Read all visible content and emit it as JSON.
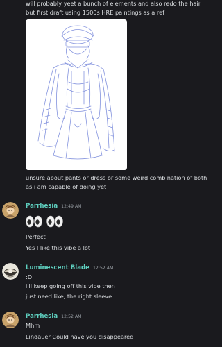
{
  "messages": {
    "first": {
      "line1": "will probably yeet a bunch of elements and also redo the hair",
      "line2": "but first draft using 1500s HRE paintings as a ref",
      "caption1": "unsure about pants or dress or some weird combination of both",
      "caption2": "as i am capable of doing yet"
    },
    "parrhesia1": {
      "username": "Parrhesia",
      "timestamp": "12:49 AM",
      "emoji": "eyes-emoji",
      "line1": "Perfect",
      "line2": "Yes I like this vibe a lot"
    },
    "luminescent": {
      "username": "Luminescent Blade",
      "timestamp": "12:52 AM",
      "line1": ":D",
      "line2": "i'll keep going off this vibe then",
      "line3": "just need like, the right sleeve"
    },
    "parrhesia2": {
      "username": "Parrhesia",
      "timestamp": "12:52 AM",
      "line1": "Mhm",
      "line2": "Lindauer Could have you disappeared"
    }
  },
  "colors": {
    "background": "#1a1a1e",
    "username": "#5fd0c0",
    "text": "#dbdee1",
    "timestamp": "#9aa0a6"
  }
}
